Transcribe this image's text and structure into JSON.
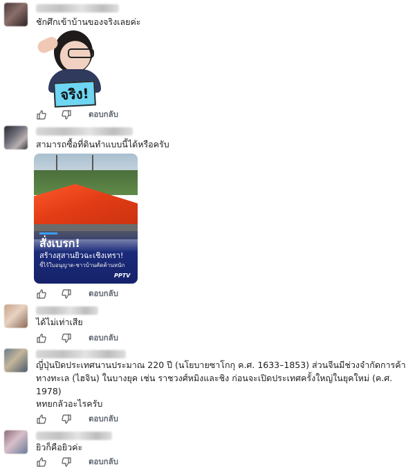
{
  "reply_label": "ตอบกลับ",
  "comments": [
    {
      "text": "ชักศึกเข้าบ้านของจริงเลยค่ะ",
      "sticker": {
        "label": "จริง!"
      }
    },
    {
      "text": "สามารถซื้อที่ดินทำแบบนี้ได้หรือครับ",
      "card": {
        "headline": "สั่งเบรก!",
        "subheadline": "สร้างสุสานยิวฉะเชิงเทรา!",
        "caption": "ชี้ไร้ใบอนุญาต-ชาวบ้านคัดค้านหนัก",
        "logo": "PPTV"
      }
    },
    {
      "text": "ได้ไม่เท่าเสีย"
    },
    {
      "lines": [
        "ญี่ปุ่นปิดประเทศนานประมาณ 220 ปี (นโยบายซาโกกุ ค.ศ. 1633–1853) ส่วนจีนมีช่วงจำกัดการค้า",
        "ทางทะเล (ไฮจิน) ในบางยุค เช่น ราชวงศ์หมิงและชิง ก่อนจะเปิดประเทศครั้งใหญ่ในยุคใหม่ (ค.ศ.",
        "1978)",
        "หทยกลัวอะไรครับ"
      ]
    },
    {
      "text": "ยิวก็คือยิวค่ะ"
    }
  ],
  "icons": {
    "like": "thumbs-up-icon",
    "dislike": "thumbs-down-icon"
  }
}
